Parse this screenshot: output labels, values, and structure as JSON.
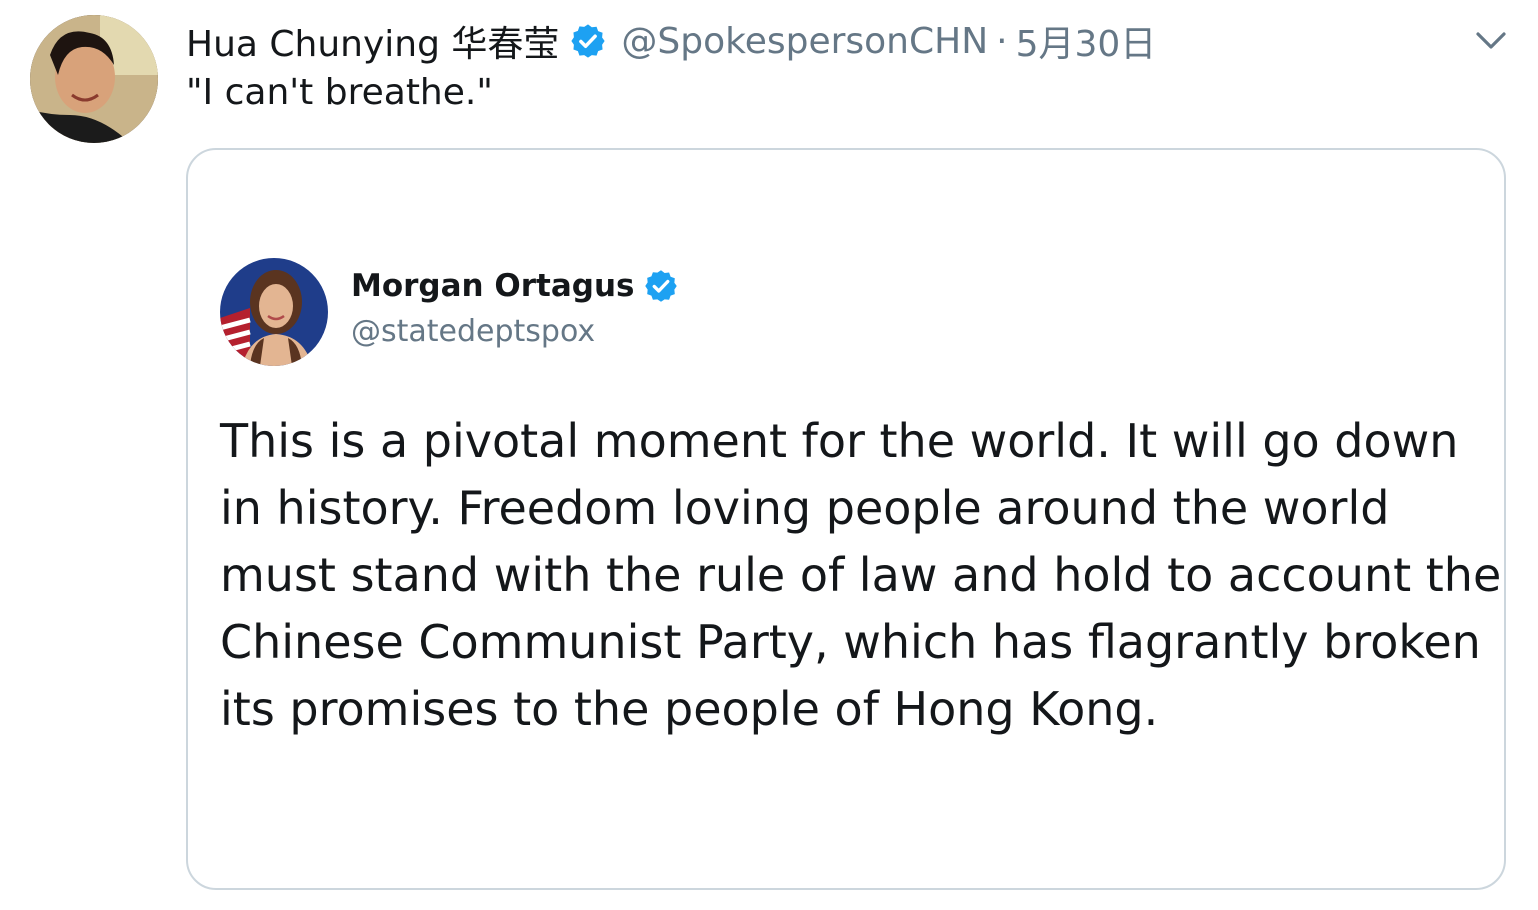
{
  "tweet": {
    "author_name": "Hua Chunying 华春莹",
    "handle": "@SpokespersonCHN",
    "separator": "·",
    "date": "5月30日",
    "text": "\"I can't breathe.\"",
    "avatar_icon": "person-photo",
    "verified_icon": "verified-badge-icon",
    "menu_icon": "chevron-down-icon"
  },
  "quoted_tweet": {
    "author_name": "Morgan Ortagus",
    "handle": "@statedeptspox",
    "avatar_icon": "person-photo",
    "verified_icon": "verified-badge-icon",
    "text_lines": [
      "This is a pivotal moment for the world. It will go down",
      "in history. Freedom loving people around the world",
      "must stand with the rule of law and hold to account the",
      "Chinese Communist Party, which has flagrantly broken",
      "its promises to the people of Hong Kong."
    ]
  },
  "colors": {
    "verified": "#1da1f2",
    "secondary_text": "#657786",
    "primary_text": "#14171a",
    "card_border": "#ccd6dd"
  }
}
